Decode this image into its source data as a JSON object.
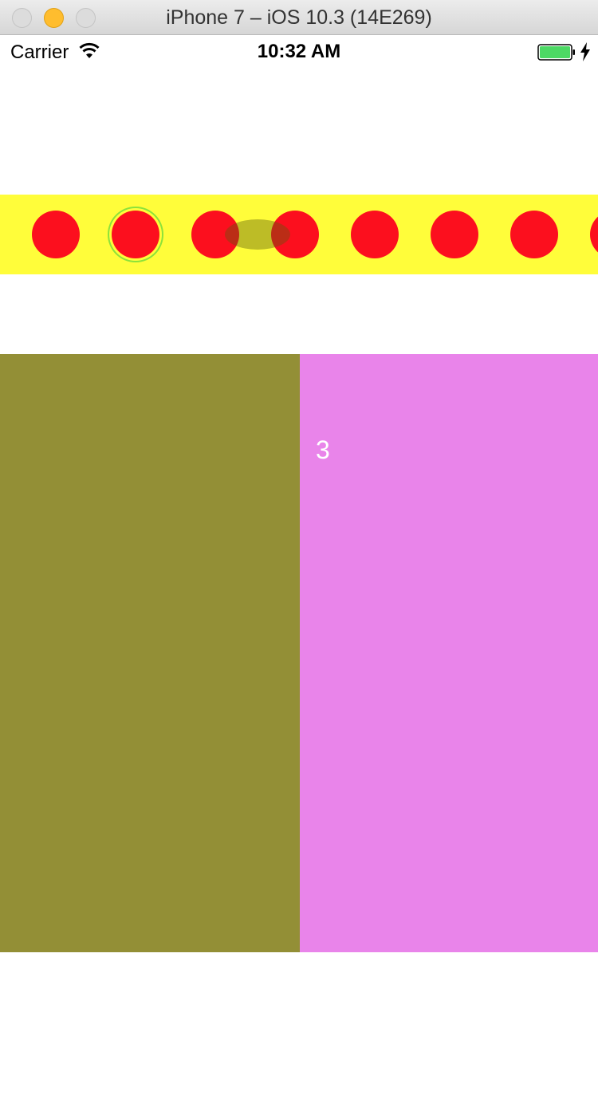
{
  "window": {
    "title": "iPhone 7 – iOS 10.3 (14E269)",
    "controls": [
      "close",
      "minimize",
      "zoom"
    ]
  },
  "status_bar": {
    "carrier": "Carrier",
    "time": "10:32 AM",
    "battery_color": "#4cd964",
    "icons": [
      "wifi-icon",
      "battery-icon",
      "charging-bolt-icon"
    ]
  },
  "dot_strip": {
    "background": "#fffd3a",
    "dot_color": "#fc0f1e",
    "dot_count_visible": 8,
    "selected_index": 1
  },
  "pages": {
    "left_color": "#938f36",
    "right_color": "#e984ea",
    "right_label": "3"
  }
}
